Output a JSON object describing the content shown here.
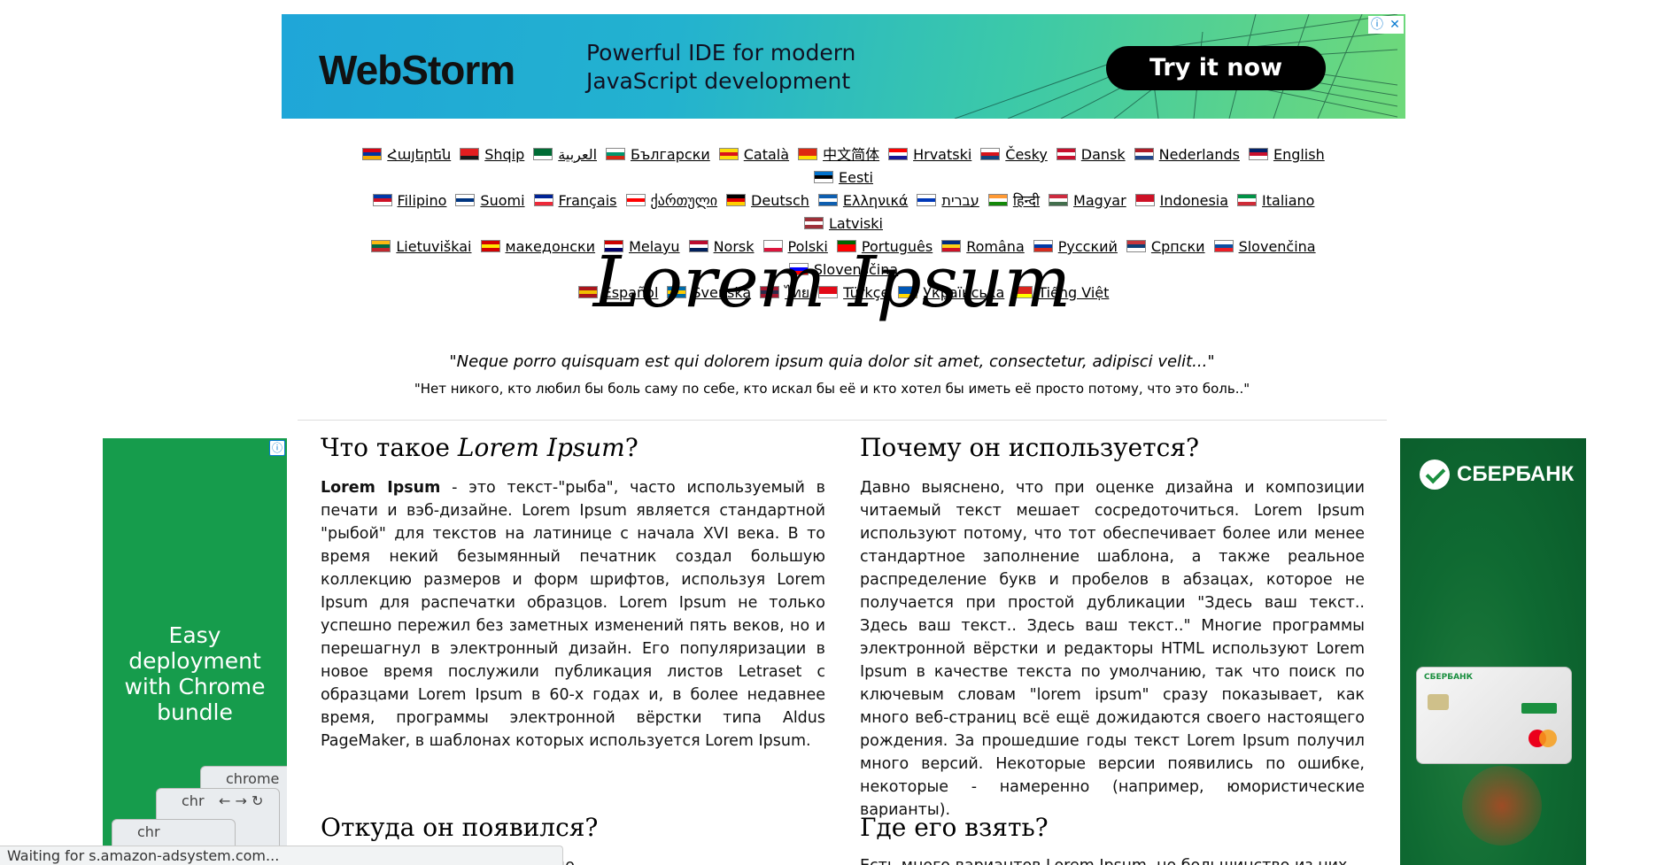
{
  "top_ad": {
    "brand": "WebStorm",
    "tagline": "Powerful IDE for modern JavaScript development",
    "cta": "Try it now",
    "adchoices_info": "ⓘ",
    "adchoices_close": "✕"
  },
  "languages": [
    {
      "label": "Հայերեն",
      "flag": [
        "#d90012",
        "#0033a0",
        "#f2a800"
      ]
    },
    {
      "label": "Shqip",
      "flag": [
        "#e41e20",
        "#e41e20",
        "#1a1a1a"
      ]
    },
    {
      "label": "العربية",
      "flag": [
        "#006c35",
        "#006c35",
        "#ffffff"
      ]
    },
    {
      "label": "Български",
      "flag": [
        "#ffffff",
        "#00966e",
        "#d62612"
      ]
    },
    {
      "label": "Català",
      "flag": [
        "#fcdd09",
        "#da121a",
        "#fcdd09"
      ]
    },
    {
      "label": "中文简体",
      "flag": [
        "#de2910",
        "#de2910",
        "#ffde00"
      ]
    },
    {
      "label": "Hrvatski",
      "flag": [
        "#ff0000",
        "#ffffff",
        "#171796"
      ]
    },
    {
      "label": "Česky",
      "flag": [
        "#ffffff",
        "#d7141a",
        "#11457e"
      ]
    },
    {
      "label": "Dansk",
      "flag": [
        "#c8102e",
        "#ffffff",
        "#c8102e"
      ]
    },
    {
      "label": "Nederlands",
      "flag": [
        "#ae1c28",
        "#ffffff",
        "#21468b"
      ]
    },
    {
      "label": "English",
      "flag": [
        "#012169",
        "#c8102e",
        "#ffffff"
      ]
    },
    {
      "label": "Eesti",
      "flag": [
        "#0072ce",
        "#000000",
        "#ffffff"
      ]
    },
    {
      "label": "Filipino",
      "flag": [
        "#0038a8",
        "#ce1126",
        "#ffffff"
      ]
    },
    {
      "label": "Suomi",
      "flag": [
        "#ffffff",
        "#003580",
        "#ffffff"
      ]
    },
    {
      "label": "Français",
      "flag": [
        "#002395",
        "#ffffff",
        "#ed2939"
      ]
    },
    {
      "label": "ქართული",
      "flag": [
        "#ffffff",
        "#ff0000",
        "#ffffff"
      ]
    },
    {
      "label": "Deutsch",
      "flag": [
        "#000000",
        "#dd0000",
        "#ffce00"
      ]
    },
    {
      "label": "Ελληνικά",
      "flag": [
        "#0d5eaf",
        "#ffffff",
        "#0d5eaf"
      ]
    },
    {
      "label": "עברית",
      "flag": [
        "#ffffff",
        "#0038b8",
        "#ffffff"
      ]
    },
    {
      "label": "हिन्दी",
      "flag": [
        "#ff9933",
        "#ffffff",
        "#138808"
      ]
    },
    {
      "label": "Magyar",
      "flag": [
        "#cd2a3e",
        "#ffffff",
        "#436f4d"
      ]
    },
    {
      "label": "Indonesia",
      "flag": [
        "#ce1126",
        "#ce1126",
        "#ffffff"
      ]
    },
    {
      "label": "Italiano",
      "flag": [
        "#009246",
        "#ffffff",
        "#ce2b37"
      ]
    },
    {
      "label": "Latviski",
      "flag": [
        "#9e3039",
        "#ffffff",
        "#9e3039"
      ]
    },
    {
      "label": "Lietuviškai",
      "flag": [
        "#fdb913",
        "#006a44",
        "#c1272d"
      ]
    },
    {
      "label": "македонски",
      "flag": [
        "#d20000",
        "#ffe600",
        "#d20000"
      ]
    },
    {
      "label": "Melayu",
      "flag": [
        "#cc0001",
        "#ffffff",
        "#010066"
      ]
    },
    {
      "label": "Norsk",
      "flag": [
        "#ba0c2f",
        "#ffffff",
        "#00205b"
      ]
    },
    {
      "label": "Polski",
      "flag": [
        "#ffffff",
        "#ffffff",
        "#dc143c"
      ]
    },
    {
      "label": "Português",
      "flag": [
        "#006600",
        "#ff0000",
        "#ff0000"
      ]
    },
    {
      "label": "Româna",
      "flag": [
        "#002b7f",
        "#fcd116",
        "#ce1126"
      ]
    },
    {
      "label": "Русский",
      "flag": [
        "#ffffff",
        "#0039a6",
        "#d52b1e"
      ]
    },
    {
      "label": "Српски",
      "flag": [
        "#c6363c",
        "#0c4076",
        "#ffffff"
      ]
    },
    {
      "label": "Slovenčina",
      "flag": [
        "#ffffff",
        "#0b4ea2",
        "#ee1c25"
      ]
    },
    {
      "label": "Slovenščina",
      "flag": [
        "#ffffff",
        "#0000ff",
        "#ff0000"
      ]
    },
    {
      "label": "Español",
      "flag": [
        "#aa151b",
        "#f1bf00",
        "#aa151b"
      ]
    },
    {
      "label": "Svenska",
      "flag": [
        "#006aa7",
        "#fecc00",
        "#006aa7"
      ]
    },
    {
      "label": "ไทย",
      "flag": [
        "#a51931",
        "#2d2a4a",
        "#a51931"
      ]
    },
    {
      "label": "Türkçe",
      "flag": [
        "#e30a17",
        "#e30a17",
        "#ffffff"
      ]
    },
    {
      "label": "Українська",
      "flag": [
        "#0057b7",
        "#0057b7",
        "#ffd700"
      ]
    },
    {
      "label": "Tiếng Việt",
      "flag": [
        "#da251d",
        "#da251d",
        "#ffff00"
      ]
    }
  ],
  "header": {
    "title": "Lorem Ipsum",
    "quote_latin": "\"Neque porro quisquam est qui dolorem ipsum quia dolor sit amet, consectetur, adipisci velit...\"",
    "quote_ru": "\"Нет никого, кто любил бы боль саму по себе, кто искал бы её и кто хотел бы иметь её просто потому, что это боль..\""
  },
  "left_ad": {
    "info": "ⓘ",
    "message": "Easy deployment with Chrome bundle",
    "window_label_1": "chrome",
    "window_label_2": "chr",
    "window_label_3": "chr"
  },
  "right_ad": {
    "brand": "СБЕРБАНК",
    "card_bank": "СБЕРБАНК"
  },
  "articles": {
    "what": {
      "heading_prefix": "Что такое ",
      "heading_em": "Lorem Ipsum",
      "heading_suffix": "?",
      "lead_bold": "Lorem Ipsum",
      "body": " - это текст-\"рыба\", часто используемый в печати и вэб-дизайне. Lorem Ipsum является стандартной \"рыбой\" для текстов на латинице с начала XVI века. В то время некий безымянный печатник создал большую коллекцию размеров и форм шрифтов, используя Lorem Ipsum для распечатки образцов. Lorem Ipsum не только успешно пережил без заметных изменений пять веков, но и перешагнул в электронный дизайн. Его популяризации в новое время послужили публикация листов Letraset с образцами Lorem Ipsum в 60-х годах и, в более недавнее время, программы электронной вёрстки типа Aldus PageMaker, в шаблонах которых используется Lorem Ipsum."
    },
    "why": {
      "heading": "Почему он используется?",
      "body": "Давно выяснено, что при оценке дизайна и композиции читаемый текст мешает сосредоточиться. Lorem Ipsum используют потому, что тот обеспечивает более или менее стандартное заполнение шаблона, а также реальное распределение букв и пробелов в абзацах, которое не получается при простой дубликации \"Здесь ваш текст.. Здесь ваш текст.. Здесь ваш текст..\" Многие программы электронной вёрстки и редакторы HTML используют Lorem Ipsum в качестве текста по умолчанию, так что поиск по ключевым словам \"lorem ipsum\" сразу показывает, как много веб-страниц всё ещё дожидаются своего настоящего рождения. За прошедшие годы текст Lorem Ipsum получил много версий. Некоторые версии появились по ошибке, некоторые - намеренно (например, юмористические варианты)."
    },
    "origin": {
      "heading": "Откуда он появился?",
      "snippet": "                    sum - взятый с потолка псевдо-"
    },
    "where": {
      "heading": "Где его взять?",
      "snippet": "Есть много вариантов Lorem Ipsum, но большинство из них"
    }
  },
  "status_bar": {
    "text": "Waiting for s.amazon-adsystem.com..."
  }
}
